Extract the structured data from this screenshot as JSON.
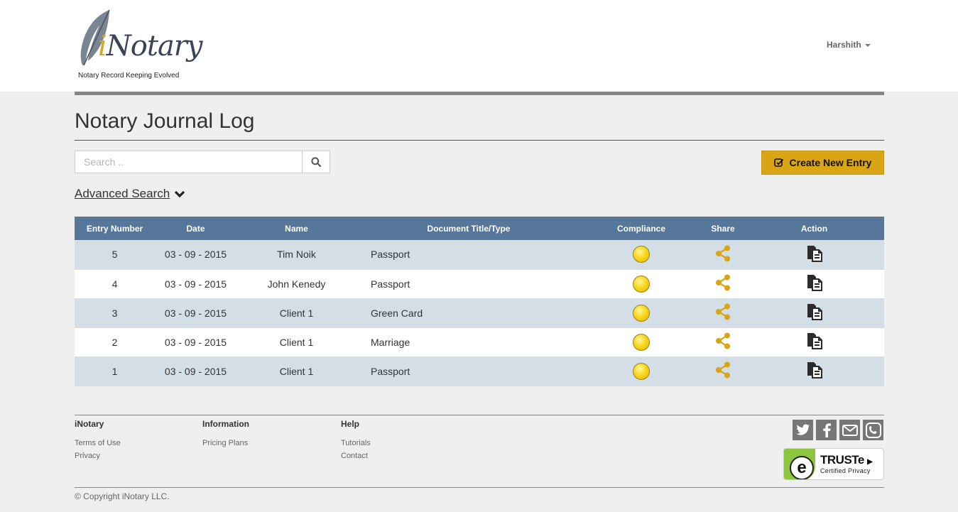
{
  "brand": {
    "logo_text_i": "i",
    "logo_text_rest": "Notary",
    "tagline": "Notary Record Keeping Evolved"
  },
  "user": {
    "name": "Harshith"
  },
  "page": {
    "title": "Notary Journal Log"
  },
  "search": {
    "placeholder": "Search .."
  },
  "create_button": {
    "label": "Create New Entry"
  },
  "advanced_search": {
    "label": "Advanced Search"
  },
  "table": {
    "headers": {
      "entry_number": "Entry Number",
      "date": "Date",
      "name": "Name",
      "document": "Document Title/Type",
      "compliance": "Compliance",
      "share": "Share",
      "action": "Action"
    },
    "rows": [
      {
        "entry": "5",
        "date": "03 - 09 - 2015",
        "name": "Tim Noik",
        "document": "Passport",
        "compliance_color": "#f5d20f"
      },
      {
        "entry": "4",
        "date": "03 - 09 - 2015",
        "name": "John Kenedy",
        "document": "Passport",
        "compliance_color": "#f5d20f"
      },
      {
        "entry": "3",
        "date": "03 - 09 - 2015",
        "name": "Client 1",
        "document": "Green Card",
        "compliance_color": "#f5d20f"
      },
      {
        "entry": "2",
        "date": "03 - 09 - 2015",
        "name": "Client 1",
        "document": "Marriage",
        "compliance_color": "#f5d20f"
      },
      {
        "entry": "1",
        "date": "03 - 09 - 2015",
        "name": "Client 1",
        "document": "Passport",
        "compliance_color": "#f5d20f"
      }
    ]
  },
  "footer": {
    "col1": {
      "heading": "iNotary",
      "links": [
        "Terms of Use",
        "Privacy"
      ]
    },
    "col2": {
      "heading": "Information",
      "links": [
        "Pricing Plans"
      ]
    },
    "col3": {
      "heading": "Help",
      "links": [
        "Tutorials",
        "Contact"
      ]
    },
    "social_icons": [
      "twitter-icon",
      "facebook-icon",
      "email-icon",
      "phone-icon"
    ],
    "truste": {
      "name": "TRUSTe",
      "arrow": "▶",
      "subtitle": "Certified Privacy"
    },
    "copyright": "© Copyright iNotary LLC."
  },
  "colors": {
    "accent": "#d9a514",
    "table_header": "#56779a",
    "row_alt": "#d3dee6",
    "share_icon": "#d9a514"
  }
}
